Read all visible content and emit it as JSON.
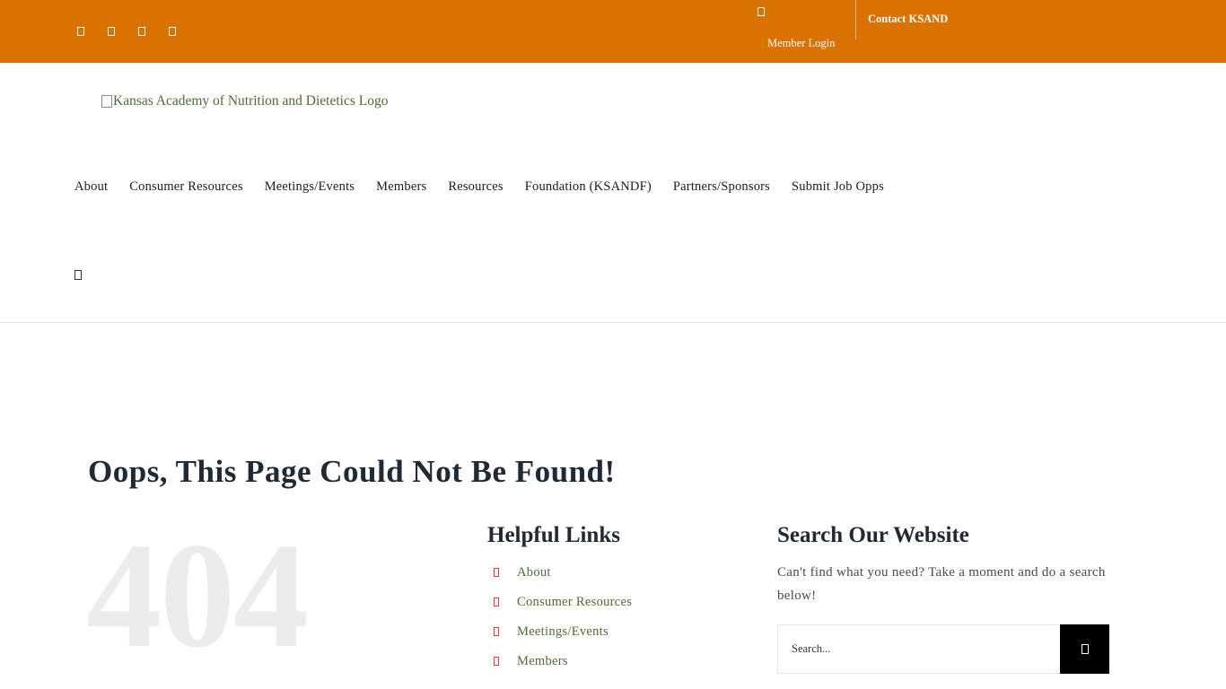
{
  "topbar": {
    "social_icons": [
      "facebook-icon",
      "twitter-icon",
      "linkedin-icon",
      "instagram-icon"
    ],
    "member_login": "Member Login",
    "contact": "Contact KSAND"
  },
  "header": {
    "logo_alt": "Kansas Academy of Nutrition and Dietetics Logo",
    "nav": [
      "About",
      "Consumer Resources",
      "Meetings/Events",
      "Members",
      "Resources",
      "Foundation (KSANDF)",
      "Partners/Sponsors",
      "Submit Job Opps"
    ]
  },
  "main": {
    "title": "Oops, This Page Could Not Be Found!",
    "code": "404",
    "helpful_links": {
      "heading": "Helpful Links",
      "items": [
        "About",
        "Consumer Resources",
        "Meetings/Events",
        "Members"
      ]
    },
    "search": {
      "heading": "Search Our Website",
      "description": "Can't find what you need? Take a moment and do a search below!",
      "placeholder": "Search..."
    }
  },
  "colors": {
    "topbar": "#d97200",
    "link": "#4e6b36",
    "bullet": "#e33b3b",
    "button": "#000000"
  }
}
